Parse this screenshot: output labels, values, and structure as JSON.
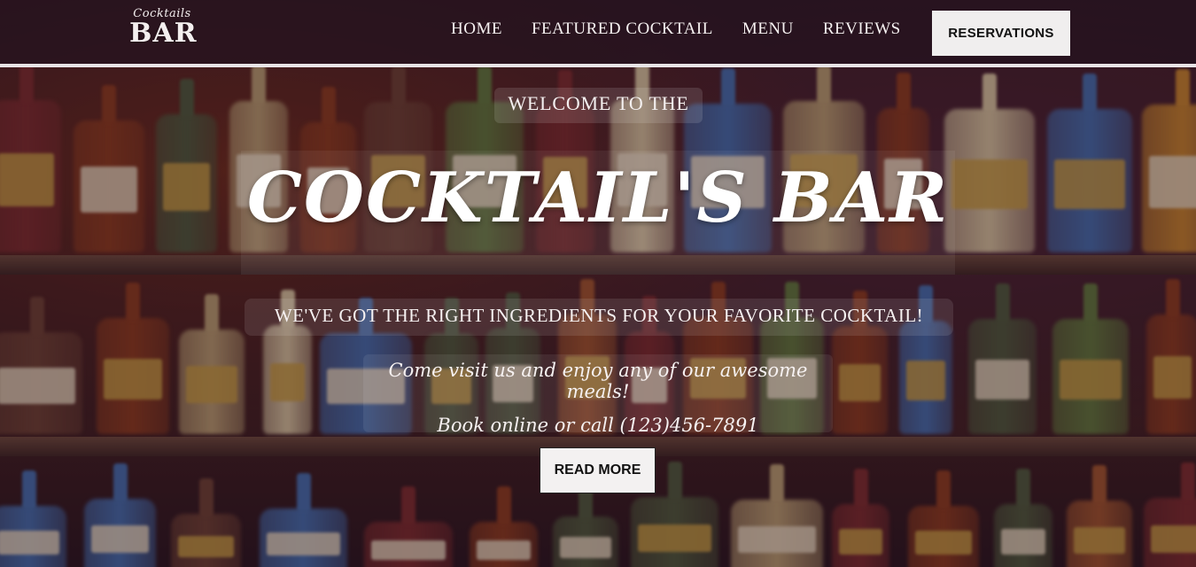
{
  "logo": {
    "small": "Cocktails",
    "big": "BAR"
  },
  "nav": {
    "items": [
      "HOME",
      "FEATURED COCKTAIL",
      "MENU",
      "REVIEWS"
    ],
    "reservations_label": "RESERVATIONS"
  },
  "hero": {
    "welcome": "WELCOME TO THE",
    "title": "COCKTAIL'S BAR",
    "subtitle": "WE'VE GOT THE RIGHT INGREDIENTS FOR YOUR FAVORITE COCKTAIL!",
    "info_line1": "Come visit us and enjoy any of our awesome meals!",
    "info_line2": "Book online or call (123)456-7891",
    "read_more_label": "READ MORE"
  },
  "colors": {
    "header_border": "#e8e4e6",
    "button_bg": "#f0eeee"
  }
}
